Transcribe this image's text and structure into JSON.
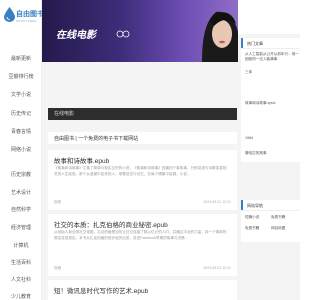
{
  "sidebar": {
    "logo_text": "自由图书",
    "logo_sub": "ZIYOU TUSHU",
    "items": [
      {
        "label": "最新更新"
      },
      {
        "label": "豆瓣排行榜"
      },
      {
        "label": "文学小说"
      },
      {
        "label": "历史传记"
      },
      {
        "label": "青春言情"
      },
      {
        "label": "网络小说"
      },
      {
        "label": "历史宗教"
      },
      {
        "label": "艺术设计"
      },
      {
        "label": "自然科学"
      },
      {
        "label": "经济管理"
      },
      {
        "label": "计算机"
      },
      {
        "label": "生活百科"
      },
      {
        "label": "人文社科"
      },
      {
        "label": "少儿教育"
      }
    ]
  },
  "banner": {
    "title": "在线电影"
  },
  "main": {
    "section_title": "在线电影",
    "site_line": "自由图书 | 一个免费的电子书下载网站",
    "articles": [
      {
        "title": "故事和诗故事.epub",
        "summary": "《故事和诗故事》汇集了简单与现实交织的小说，《故事和诗故事》四篇四个事故事，分别讲述与诗歌息息相关的人生经验，那个从遗憾中走来的人，带着信念与记忆，在每个情景中延展，小说...",
        "author": "投稿",
        "date": "2024-06-01 10:21"
      },
      {
        "title": "社交的本质：扎克伯格的商业秘密.epub",
        "summary": "从创始人到全球社交帝国，扎克伯格是如何让社交连接了数以亿计的人们，并通过平台的力量，将一个简单的想法变成现实。本书从扎克伯格的成长经历出发，讲述Facebook早期的故事与决策...",
        "author": "投稿",
        "date": "2024-06-01 10:21"
      },
      {
        "title": "短！微讯息时代写作的艺术.epub",
        "summary": "",
        "author": "",
        "date": ""
      }
    ]
  },
  "right": {
    "hot_title": "热门文章",
    "hot_items": [
      {
        "label": "从人工智能从公开从前年行：场一团我同一无人客满事"
      },
      {
        "label": "三体"
      },
      {
        "label": "故事和诗故事.epub"
      },
      {
        "label": "1984"
      },
      {
        "label": "撒哈拉的故事"
      }
    ],
    "links_title": "网站导航",
    "links": [
      {
        "label": "短篇小说"
      },
      {
        "label": "免费书籍"
      },
      {
        "label": "免费书籍"
      },
      {
        "label": "网站地图"
      }
    ]
  },
  "colors": {
    "accent": "#3a7fc4",
    "banner_start": "#231a4a",
    "banner_end": "#8f6ec8",
    "dark_bar": "#2d2d2d"
  }
}
